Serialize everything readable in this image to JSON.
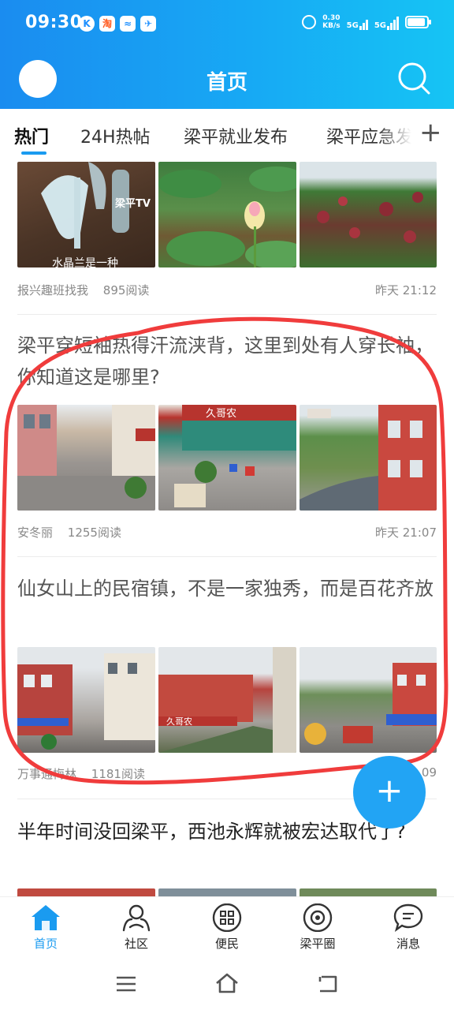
{
  "status_bar": {
    "time": "09:30",
    "app_icons": [
      "K",
      "淘",
      "≈",
      "✈"
    ],
    "net_speed": "0.30",
    "net_unit": "KB/s",
    "sig1": "5G",
    "sig2": "5G"
  },
  "header": {
    "title": "首页"
  },
  "tabs": [
    "热门",
    "24H热帖",
    "梁平就业发布",
    "梁平应急发"
  ],
  "feed": {
    "item0": {
      "source": "报兴趣班找我",
      "reads": "895阅读",
      "date": "昨天 21:12",
      "img0_text": "水晶兰是一种",
      "img0_logo": "梁平TV"
    },
    "item1": {
      "title": "梁平穿短袖热得汗流浃背，这里到处有人穿长袖，你知道这是哪里?",
      "source": "安冬丽",
      "reads": "1255阅读",
      "date": "昨天 21:07",
      "shop_sign": "久哥农"
    },
    "item2": {
      "title": "仙女山上的民宿镇，不是一家独秀，而是百花齐放",
      "source": "万事通梅林",
      "reads": "1181阅读",
      "date": "09",
      "shop_sign": "久哥农"
    },
    "item3": {
      "title": "半年时间没回梁平，西池永辉就被宏达取代了?"
    }
  },
  "fab": {
    "label": "+"
  },
  "bottom_nav": [
    {
      "label": "首页"
    },
    {
      "label": "社区"
    },
    {
      "label": "便民"
    },
    {
      "label": "梁平圈"
    },
    {
      "label": "消息"
    }
  ],
  "colors": {
    "accent": "#1a9bf0",
    "annotation": "#f03c3c"
  }
}
